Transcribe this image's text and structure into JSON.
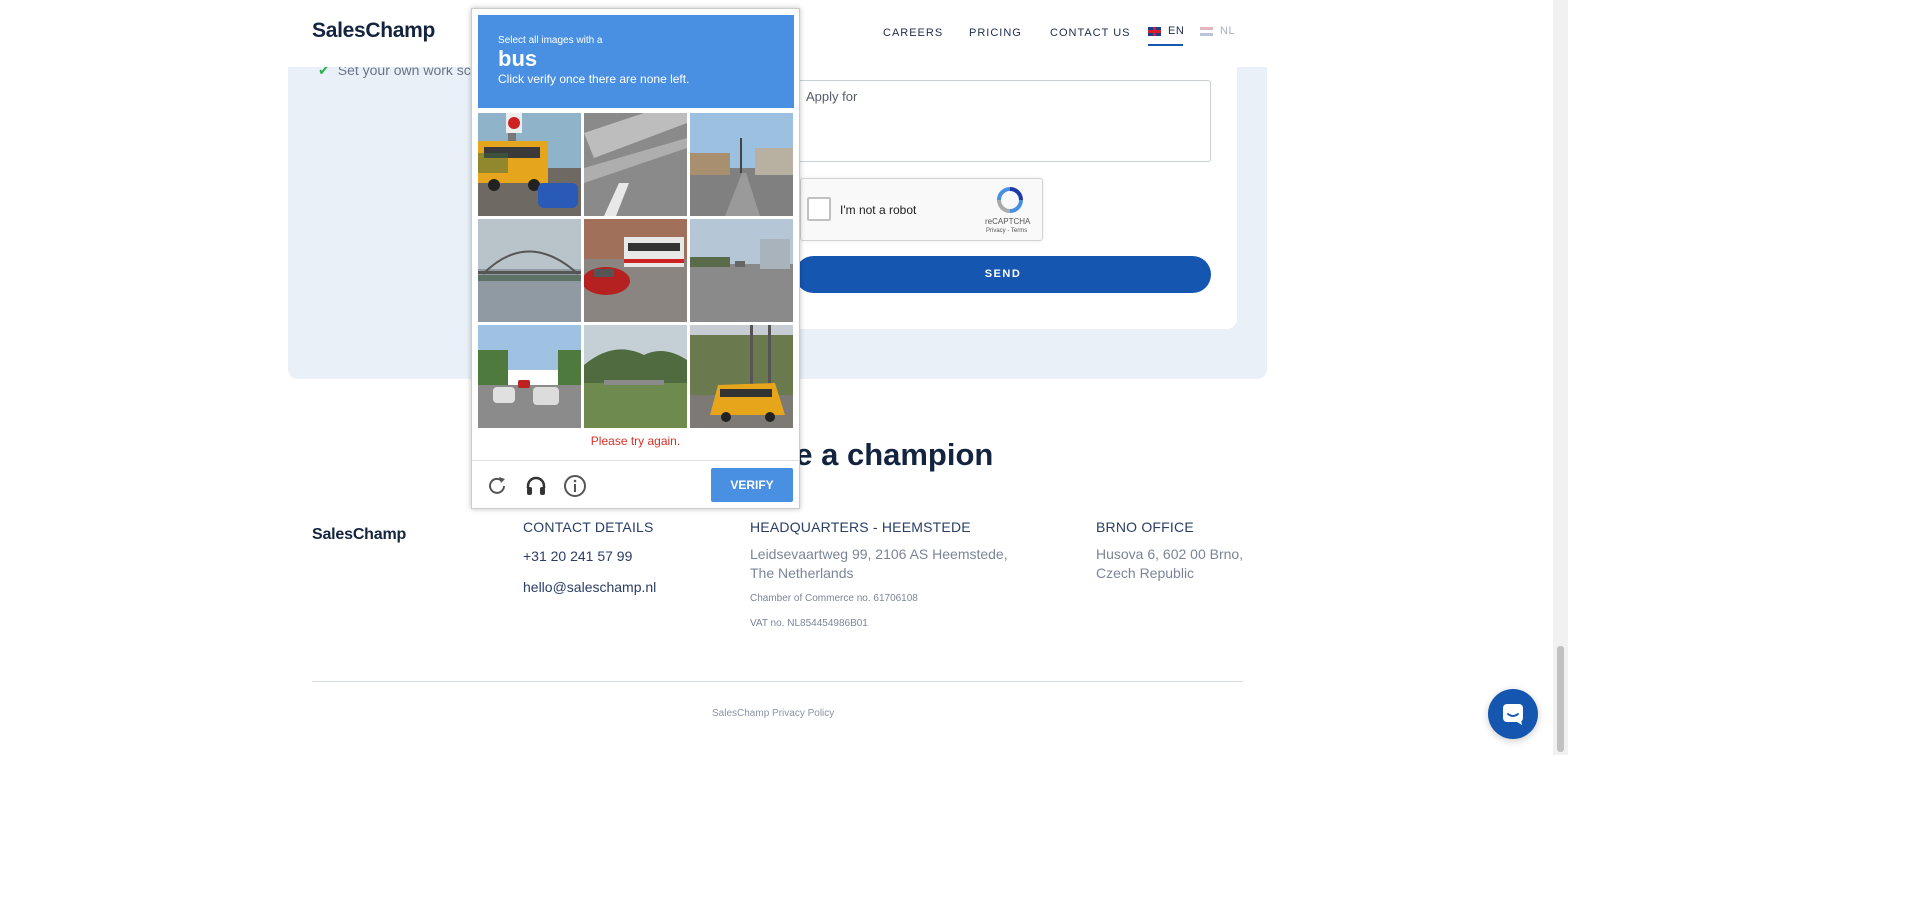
{
  "header": {
    "logo": "SalesChamp",
    "nav": [
      "CAREERS",
      "PRICING",
      "CONTACT US"
    ],
    "lang_en": "EN",
    "lang_nl": "NL"
  },
  "section": {
    "check_text": "Set your own work sc",
    "textarea_value": "Apply for",
    "recaptcha_label": "I'm not a robot",
    "recaptcha_brand": "reCAPTCHA",
    "recaptcha_terms": "Privacy - Terms",
    "send_label": "SEND",
    "heading": "ke a champion"
  },
  "captcha": {
    "line1": "Select all images with a",
    "target": "bus",
    "line2": "Click verify once there are none left.",
    "error": "Please try again.",
    "verify_label": "VERIFY",
    "header_color": "#4a90e2"
  },
  "footer": {
    "logo": "SalesChamp",
    "contact_heading": "CONTACT DETAILS",
    "phone": "+31 20 241 57 99",
    "email": "hello@saleschamp.nl",
    "hq_heading": "HEADQUARTERS - HEEMSTEDE",
    "hq_address_1": "Leidsevaartweg 99, 2106 AS Heemstede,",
    "hq_address_2": "The Netherlands",
    "chamber": "Chamber of Commerce no. 61706108",
    "vat": "VAT no. NL854454986B01",
    "brno_heading": "BRNO OFFICE",
    "brno_address_1": "Husova 6, 602 00 Brno,",
    "brno_address_2": "Czech Republic",
    "policy": "SalesChamp Privacy Policy"
  }
}
